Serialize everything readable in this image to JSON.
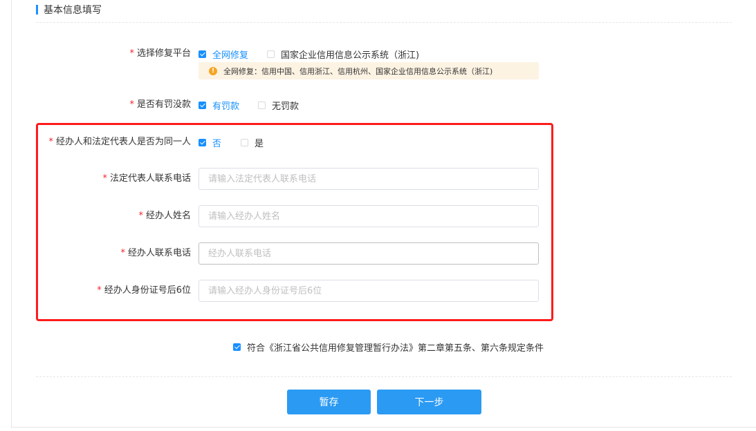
{
  "section": {
    "title": "基本信息填写"
  },
  "required_mark": "*",
  "platform": {
    "label": "选择修复平台",
    "options": [
      {
        "label": "全网修复",
        "checked": true
      },
      {
        "label": "国家企业信用信息公示系统（浙江)",
        "checked": false
      }
    ],
    "notice_icon": "warning-icon",
    "notice_icon_glyph": "!",
    "notice": "全网修复：信用中国、信用浙江、信用杭州、国家企业信用信息公示系统（浙江)"
  },
  "penalty": {
    "label": "是否有罚没款",
    "options": [
      {
        "label": "有罚款",
        "checked": true
      },
      {
        "label": "无罚款",
        "checked": false
      }
    ]
  },
  "same_person": {
    "label": "经办人和法定代表人是否为同一人",
    "options": [
      {
        "label": "否",
        "checked": true
      },
      {
        "label": "是",
        "checked": false
      }
    ]
  },
  "fields": [
    {
      "label": "法定代表人联系电话",
      "value": "",
      "placeholder": "请输入法定代表人联系电话"
    },
    {
      "label": "经办人姓名",
      "value": "",
      "placeholder": "请输入经办人姓名"
    },
    {
      "label": "经办人联系电话",
      "value": "",
      "placeholder": "经办人联系电话"
    },
    {
      "label": "经办人身份证号后6位",
      "value": "",
      "placeholder": "请输入经办人身份证号后6位"
    }
  ],
  "agreement": {
    "checked": true,
    "label": "符合《浙江省公共信用修复管理暂行办法》第二章第五条、第六条规定条件"
  },
  "buttons": {
    "save": "暂存",
    "next": "下一步"
  },
  "colors": {
    "accent": "#1890ff",
    "button": "#2b9af3",
    "highlight": "#ff1a1a",
    "required": "#f5222d",
    "notice_bg": "#fdf3e3",
    "warning": "#f5a623"
  }
}
